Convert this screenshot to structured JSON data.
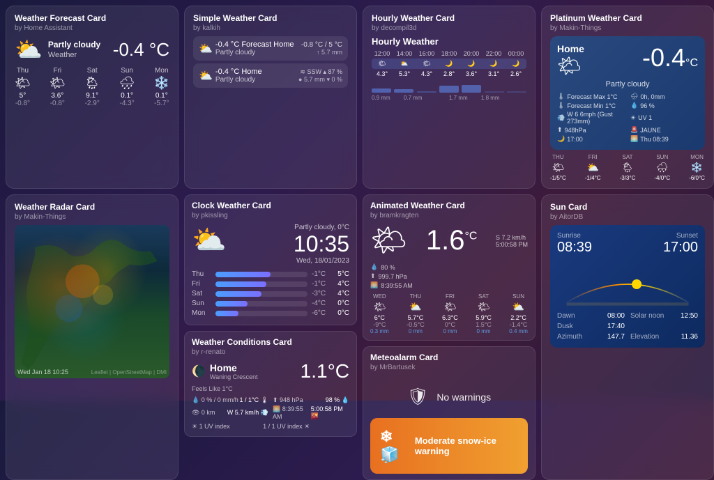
{
  "forecast_card": {
    "title": "Weather Forecast Card",
    "author": "by Home Assistant",
    "condition": "Partly cloudy",
    "condition_label": "Weather",
    "temp": "-0.4 °C",
    "days": [
      {
        "name": "Thu",
        "icon": "🌤",
        "high": "5°",
        "low": "-0.8°"
      },
      {
        "name": "Fri",
        "icon": "🌤",
        "high": "3.6°",
        "low": "-0.8°"
      },
      {
        "name": "Sat",
        "icon": "🌦",
        "high": "9.1°",
        "low": "-2.9°"
      },
      {
        "name": "Sun",
        "icon": "🌧",
        "high": "0.1°",
        "low": "-4.3°"
      },
      {
        "name": "Mon",
        "icon": "❄",
        "high": "0.1°",
        "low": "-5.7°"
      }
    ]
  },
  "radar_card": {
    "title": "Weather Radar Card",
    "author": "by Makin-Things",
    "timestamp": "Wed Jan 18 10:25",
    "attribution": "Leaflet | OpenStreetMap | DMI"
  },
  "simple_card": {
    "title": "Simple Weather Card",
    "author": "by kalkih",
    "rows": [
      {
        "temp": "-0.4 °C Forecast Home",
        "desc": "Partly cloudy",
        "right_top": "-0.8 °C / 5 °C",
        "right_bottom": "↑ 5.7 mm"
      },
      {
        "temp": "-0.4 °C Home",
        "desc": "Partly cloudy",
        "wind": "≋ SSW ▴ 87 %",
        "precip": "● 5.7 mm ▾ 0 %"
      }
    ]
  },
  "clock_card": {
    "title": "Clock Weather Card",
    "author": "by pkissling",
    "condition": "Partly cloudy, 0°C",
    "time": "10:35",
    "date": "Wed, 18/01/2023",
    "days": [
      {
        "name": "Thu",
        "temp_low": "-1°C",
        "temp_high": "5°C",
        "bar_pct": 60
      },
      {
        "name": "Fri",
        "temp_low": "-1°C",
        "temp_high": "4°C",
        "bar_pct": 55
      },
      {
        "name": "Sat",
        "temp_low": "-3°C",
        "temp_high": "4°C",
        "bar_pct": 50
      },
      {
        "name": "Sun",
        "temp_low": "-4°C",
        "temp_high": "0°C",
        "bar_pct": 35
      },
      {
        "name": "Mon",
        "temp_low": "-6°C",
        "temp_high": "0°C",
        "bar_pct": 25
      }
    ]
  },
  "conditions_card": {
    "title": "Weather Conditions Card",
    "author": "by r-renato",
    "location": "Home",
    "moon": "Waning Crescent",
    "temp": "1.1°C",
    "feels_like": "Feels Like 1°C",
    "stats": [
      {
        "label": "0 % / 0 mm/h",
        "right": "1 / 1°C"
      },
      {
        "label": "948 hPa",
        "right": "98 %"
      },
      {
        "label": "0 km",
        "right": "W 5.7 km/h"
      },
      {
        "label": "8:39:55 AM",
        "right": "5:00:58 PM"
      },
      {
        "label": "☀ 1 UV index",
        "right": "1 / 1 UV index"
      }
    ]
  },
  "hourly_card": {
    "title": "Hourly Weather Card",
    "author": "by decompil3d",
    "subtitle": "Hourly Weather",
    "hours": [
      {
        "time": "12:00",
        "icon": "🌤",
        "temp": "4.3°",
        "wind": ""
      },
      {
        "time": "14:00",
        "icon": "⛅",
        "temp": "5.3°",
        "wind": ""
      },
      {
        "time": "16:00",
        "icon": "🌤",
        "temp": "4.3°",
        "wind": ""
      },
      {
        "time": "18:00",
        "icon": "🌙",
        "temp": "2.8°",
        "wind": ""
      },
      {
        "time": "20:00",
        "icon": "🌙",
        "temp": "3.6°",
        "wind": ""
      },
      {
        "time": "22:00",
        "icon": "🌙",
        "temp": "3.1°",
        "wind": ""
      },
      {
        "time": "00:00",
        "icon": "🌙",
        "temp": "2.6°",
        "wind": ""
      }
    ],
    "rain_labels": [
      "0.9 mm",
      "0.7 mm",
      "",
      "1.7 mm",
      "1.8 mm"
    ]
  },
  "animated_card": {
    "title": "Animated Weather Card",
    "author": "by bramkragten",
    "temp": "1.6",
    "unit": "°C",
    "humidity": "80 %",
    "pressure": "999.7 hPa",
    "sunrise": "8:39:55 AM",
    "wind_speed": "S 7.2 km/h",
    "sunset": "5:00:58 PM",
    "days": [
      {
        "name": "WED",
        "icon": "🌤",
        "high": "6°C",
        "low": "-9°C",
        "precip": "0.3 mm"
      },
      {
        "name": "THU",
        "icon": "⛅",
        "high": "5.7°C",
        "low": "-0.5°C",
        "precip": "0 mm"
      },
      {
        "name": "FRI",
        "icon": "🌤",
        "high": "6.3°C",
        "low": "0°C",
        "precip": "0 mm"
      },
      {
        "name": "SAT",
        "icon": "🌤",
        "high": "5.9°C",
        "low": "1.5°C",
        "precip": "0 mm"
      },
      {
        "name": "SUN",
        "icon": "⛅",
        "high": "2.2°C",
        "low": "-1.4°C",
        "precip": "0.4 mm"
      }
    ]
  },
  "meteo_card": {
    "title": "Meteoalarm Card",
    "author": "by MrBartusek",
    "no_warnings": "No warnings",
    "snow_warning": "Moderate snow-ice warning"
  },
  "platinum_card": {
    "title": "Platinum Weather Card",
    "author": "by Makin-Things",
    "location": "Home",
    "temp": "-0.4",
    "unit": "°C",
    "condition": "Partly cloudy",
    "stats": [
      "Forecast Max 1°C",
      "0h, 0mm",
      "Forecast Min 1°C",
      "96 %",
      "W 6 6mph (Gust 273mm)",
      "UV 1",
      "948hPa",
      "JAUNE",
      "17:00",
      "Thu 08:39"
    ],
    "days": [
      {
        "name": "THU",
        "icon": "🌤",
        "high": "-1/5°C"
      },
      {
        "name": "FRI",
        "icon": "⛅",
        "high": "-1/4°C"
      },
      {
        "name": "SAT",
        "icon": "🌦",
        "high": "-3/3°C"
      },
      {
        "name": "SUN",
        "icon": "🌧",
        "high": "-4/0°C"
      },
      {
        "name": "MON",
        "icon": "❄",
        "high": "-6/0°C"
      }
    ]
  },
  "sun_card": {
    "title": "Sun Card",
    "author": "by AitorDB",
    "sunrise": "08:39",
    "sunset": "17:00",
    "dawn": "08:00",
    "solar_noon": "12:50",
    "dusk": "17:40",
    "azimuth": "147.7",
    "elevation": "11.36"
  }
}
